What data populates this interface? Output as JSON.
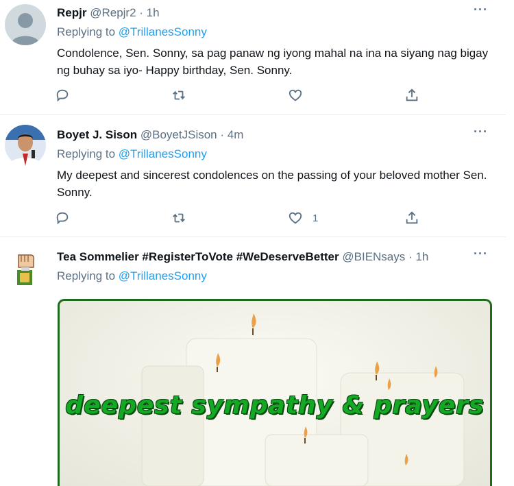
{
  "tweets": [
    {
      "name": "Repjr",
      "meta": "@Repjr2 · 1h",
      "replying_prefix": "Replying to ",
      "replying_handle": "@TrillanesSonny",
      "text": "Condolence, Sen. Sonny, sa pag panaw ng iyong mahal na ina na siyang nag bigay ng buhay sa iyo- Happy birthday, Sen. Sonny.",
      "likes": ""
    },
    {
      "name": "Boyet J. Sison",
      "meta": "@BoyetJSison · 4m",
      "replying_prefix": "Replying to ",
      "replying_handle": "@TrillanesSonny",
      "text": "My deepest and sincerest condolences on the passing of your beloved mother Sen. Sonny.",
      "likes": "1"
    },
    {
      "name": "Tea Sommelier #RegisterToVote #WeDeserveBetter",
      "meta": "@BIENsays · 1h",
      "replying_prefix": "Replying to ",
      "replying_handle": "@TrillanesSonny",
      "media_text": "deepest sympathy & prayers"
    }
  ],
  "more_label": "···",
  "icons": [
    "reply-icon",
    "retweet-icon",
    "like-icon",
    "share-icon",
    "more-icon"
  ],
  "colors": {
    "link": "#1da1f2",
    "muted": "#5b7083",
    "media_border": "#1e6b1e",
    "media_text": "#14a824"
  }
}
